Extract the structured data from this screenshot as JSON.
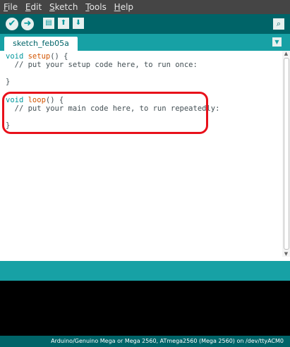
{
  "menu": {
    "items": [
      {
        "first": "F",
        "rest": "ile"
      },
      {
        "first": "E",
        "rest": "dit"
      },
      {
        "first": "S",
        "rest": "ketch"
      },
      {
        "first": "T",
        "rest": "ools"
      },
      {
        "first": "H",
        "rest": "elp"
      }
    ]
  },
  "toolbar": {
    "verify_icon": "checkmark-icon",
    "upload_icon": "right-arrow-icon",
    "new_icon": "new-file-icon",
    "open_icon": "up-arrow-icon",
    "save_icon": "down-arrow-icon",
    "serial_monitor_icon": "magnifier-icon"
  },
  "tabs": [
    {
      "label": "sketch_feb05a"
    }
  ],
  "editor": {
    "lines": [
      {
        "kw": "void ",
        "fn": "setup",
        "rest": "() {"
      },
      {
        "text": "  // put your setup code here, to run once:"
      },
      {
        "text": ""
      },
      {
        "text": "}"
      },
      {
        "text": ""
      },
      {
        "kw": "void ",
        "fn": "loop",
        "rest": "() {"
      },
      {
        "text": "  // put your main code here, to run repeatedly:"
      },
      {
        "text": ""
      },
      {
        "text": "}"
      }
    ]
  },
  "footer": {
    "board_text": "Arduino/Genuino Mega or Mega 2560, ATmega2560 (Mega 2560) on /dev/ttyACM0"
  },
  "colors": {
    "menubar_bg": "#454545",
    "toolbar_bg": "#006468",
    "tabstrip_bg": "#17a1a5",
    "highlight": "#e8101a"
  }
}
